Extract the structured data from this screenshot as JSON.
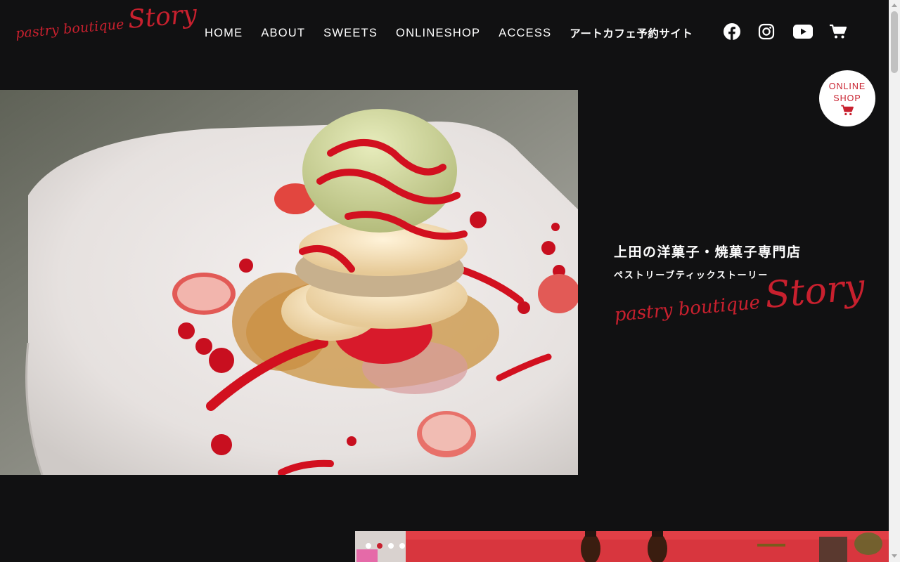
{
  "brand": {
    "small": "pastry boutique",
    "big": "Story",
    "color": "#c8202e"
  },
  "nav": {
    "items": [
      {
        "label": "HOME"
      },
      {
        "label": "ABOUT"
      },
      {
        "label": "SWEETS"
      },
      {
        "label": "ONLINESHOP"
      },
      {
        "label": "ACCESS"
      },
      {
        "label": "アートカフェ予約サイト"
      }
    ]
  },
  "social_icons": [
    "facebook-icon",
    "instagram-icon",
    "youtube-icon",
    "cart-icon"
  ],
  "online_shop_badge": {
    "line1": "ONLINE",
    "line2": "SHOP",
    "icon": "cart-icon"
  },
  "hero": {
    "image": "plated strawberry pistachio dessert",
    "heading": "上田の洋菓子・焼菓子専門店",
    "subheading": "ペストリーブティックストーリー",
    "logo_small": "pastry boutique",
    "logo_big": "Story"
  },
  "slider": {
    "dot_count": 4,
    "active_index": 1
  },
  "colors": {
    "background": "#111112",
    "accent": "#c8202e",
    "text": "#ffffff"
  }
}
